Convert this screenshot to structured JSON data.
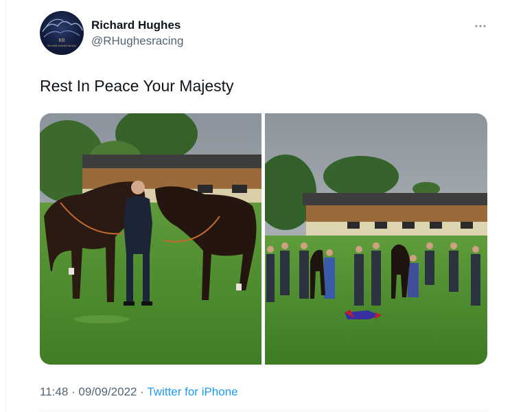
{
  "tweet": {
    "author_name": "Richard Hughes",
    "author_handle": "@RHughesracing",
    "avatar_text_top": "RR",
    "avatar_text_bottom": "RICHARD HUGHES RACING",
    "text": "Rest In Peace Your Majesty",
    "time": "11:48",
    "separator": "·",
    "date": "09/09/2022",
    "source": "Twitter for iPhone"
  },
  "media": {
    "photo_1": "two-horses-with-trainer-photo",
    "photo_2": "staff-gathered-on-lawn-photo"
  },
  "icons": {
    "more": "more-horizontal-icon"
  },
  "colors": {
    "text": "#0f1419",
    "secondary": "#536471",
    "link": "#1d9bf0",
    "divider": "#eff3f4"
  }
}
